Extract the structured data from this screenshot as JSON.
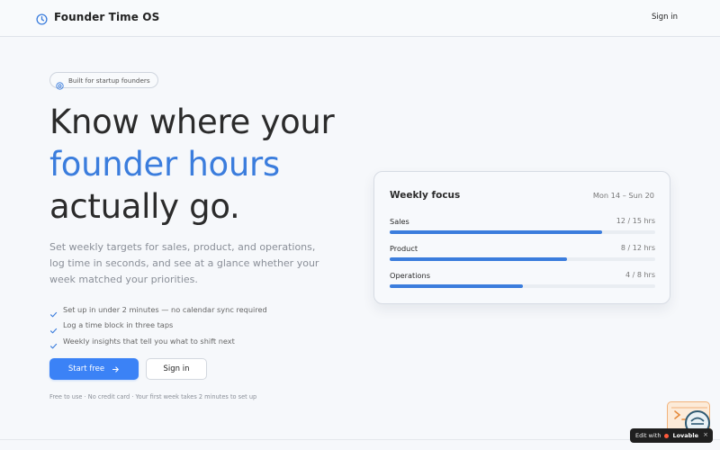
{
  "header": {
    "brand_name": "Founder Time OS",
    "signin_label": "Sign in"
  },
  "hero": {
    "badge": "Built for startup founders",
    "headline_line1": "Know where your",
    "headline_line2": "founder hours",
    "headline_line3": "actually go.",
    "subtext": "Set weekly targets for sales, product, and operations, log time in seconds, and see at a glance whether your week matched your priorities.",
    "checks": [
      "Set up in under 2 minutes — no calendar sync required",
      "Log a time block in three taps",
      "Weekly insights that tell you what to shift next"
    ],
    "primary_button": "Start free",
    "secondary_button": "Sign in",
    "footnote": "Free to use · No credit card · Your first week takes 2 minutes to set up"
  },
  "card": {
    "title": "Weekly focus",
    "range": "Mon 14 – Sun 20",
    "rows": [
      {
        "label": "Sales",
        "value": "12 / 15 hrs",
        "progress": 0.8
      },
      {
        "label": "Product",
        "value": "8 / 12 hrs",
        "progress": 0.667
      },
      {
        "label": "Operations",
        "value": "4 / 8 hrs",
        "progress": 0.5
      }
    ]
  },
  "widget": {
    "edit_with": "Edit with",
    "brand": "Lovable",
    "close": "×"
  },
  "colors": {
    "accent": "#3b7ddd",
    "primary_button": "#3b82f6"
  },
  "icons": {
    "brand": "clock-icon",
    "badge": "at-sign-icon",
    "check": "check-icon",
    "button": "arrow-right-icon"
  }
}
